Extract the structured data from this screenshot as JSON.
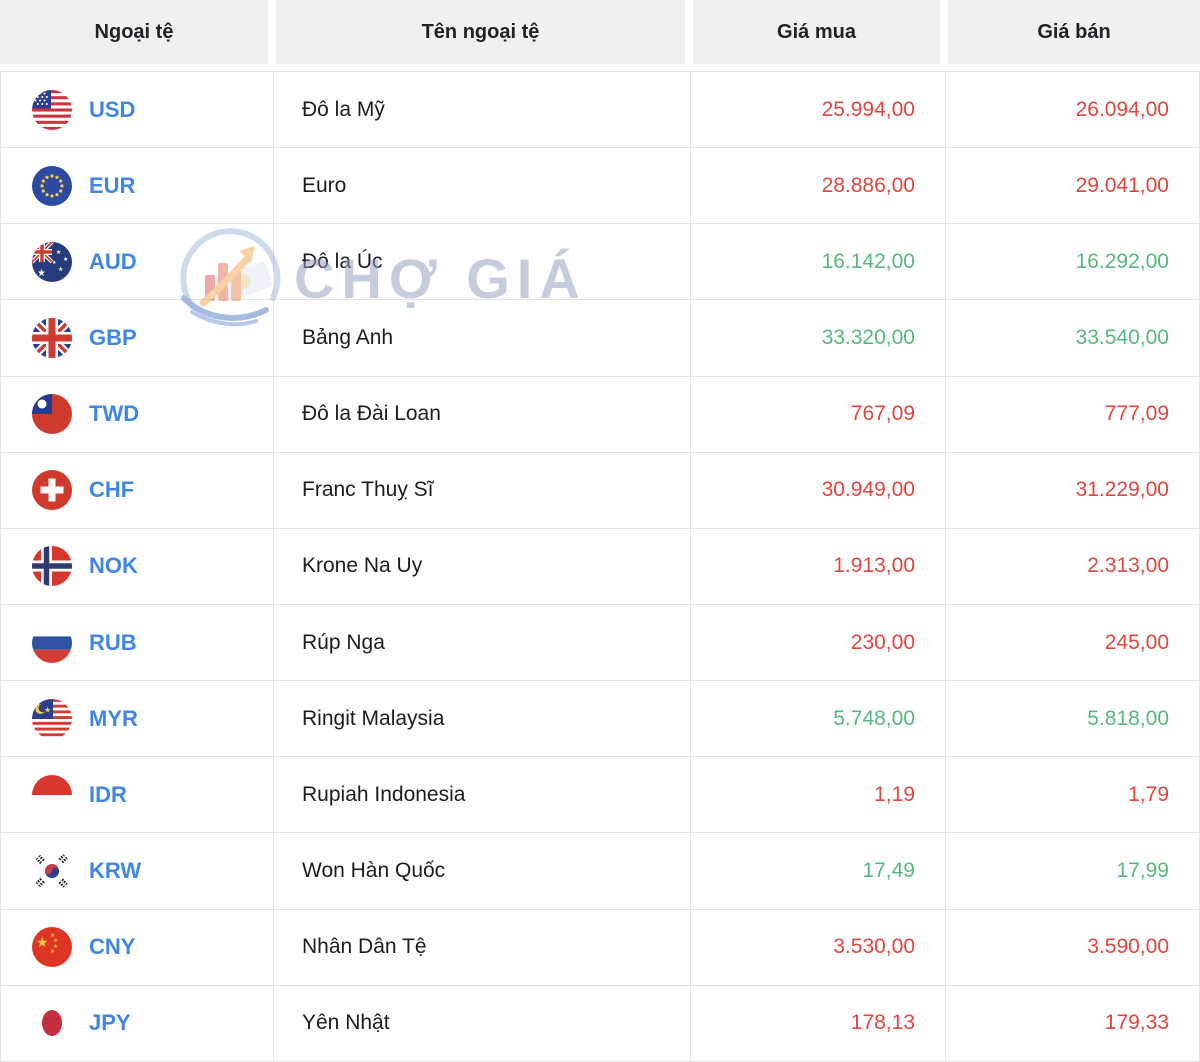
{
  "watermark": {
    "text": "CHỢ GIÁ"
  },
  "colors": {
    "header_bg": "#f0f0f1",
    "header_text": "#212226",
    "code_blue": "#3f86e5",
    "name_text": "#1b1c1e",
    "price_red": "#e2453c",
    "price_green": "#55b97e",
    "border": "#e3e3e6",
    "watermark_text": "#96a3c4"
  },
  "table": {
    "columns": [
      "Ngoại tệ",
      "Tên ngoại tệ",
      "Giá mua",
      "Giá bán"
    ],
    "rows": [
      {
        "code": "USD",
        "name": "Đô la Mỹ",
        "buy": "25.994,00",
        "sell": "26.094,00",
        "trend": "red",
        "flag": "flag-usd"
      },
      {
        "code": "EUR",
        "name": "Euro",
        "buy": "28.886,00",
        "sell": "29.041,00",
        "trend": "red",
        "flag": "flag-eur"
      },
      {
        "code": "AUD",
        "name": "Đô la Úc",
        "buy": "16.142,00",
        "sell": "16.292,00",
        "trend": "green",
        "flag": "flag-aud"
      },
      {
        "code": "GBP",
        "name": "Bảng Anh",
        "buy": "33.320,00",
        "sell": "33.540,00",
        "trend": "green",
        "flag": "flag-gbp"
      },
      {
        "code": "TWD",
        "name": "Đô la Đài Loan",
        "buy": "767,09",
        "sell": "777,09",
        "trend": "red",
        "flag": "flag-twd"
      },
      {
        "code": "CHF",
        "name": "Franc Thuỵ Sĩ",
        "buy": "30.949,00",
        "sell": "31.229,00",
        "trend": "red",
        "flag": "flag-chf"
      },
      {
        "code": "NOK",
        "name": "Krone Na Uy",
        "buy": "1.913,00",
        "sell": "2.313,00",
        "trend": "red",
        "flag": "flag-nok"
      },
      {
        "code": "RUB",
        "name": "Rúp Nga",
        "buy": "230,00",
        "sell": "245,00",
        "trend": "red",
        "flag": "flag-rub"
      },
      {
        "code": "MYR",
        "name": "Ringit Malaysia",
        "buy": "5.748,00",
        "sell": "5.818,00",
        "trend": "green",
        "flag": "flag-myr"
      },
      {
        "code": "IDR",
        "name": "Rupiah Indonesia",
        "buy": "1,19",
        "sell": "1,79",
        "trend": "red",
        "flag": "flag-idr"
      },
      {
        "code": "KRW",
        "name": "Won Hàn Quốc",
        "buy": "17,49",
        "sell": "17,99",
        "trend": "green",
        "flag": "flag-krw"
      },
      {
        "code": "CNY",
        "name": "Nhân Dân Tệ",
        "buy": "3.530,00",
        "sell": "3.590,00",
        "trend": "red",
        "flag": "flag-cny"
      },
      {
        "code": "JPY",
        "name": "Yên Nhật",
        "buy": "178,13",
        "sell": "179,33",
        "trend": "red",
        "flag": "flag-jpy"
      }
    ]
  }
}
